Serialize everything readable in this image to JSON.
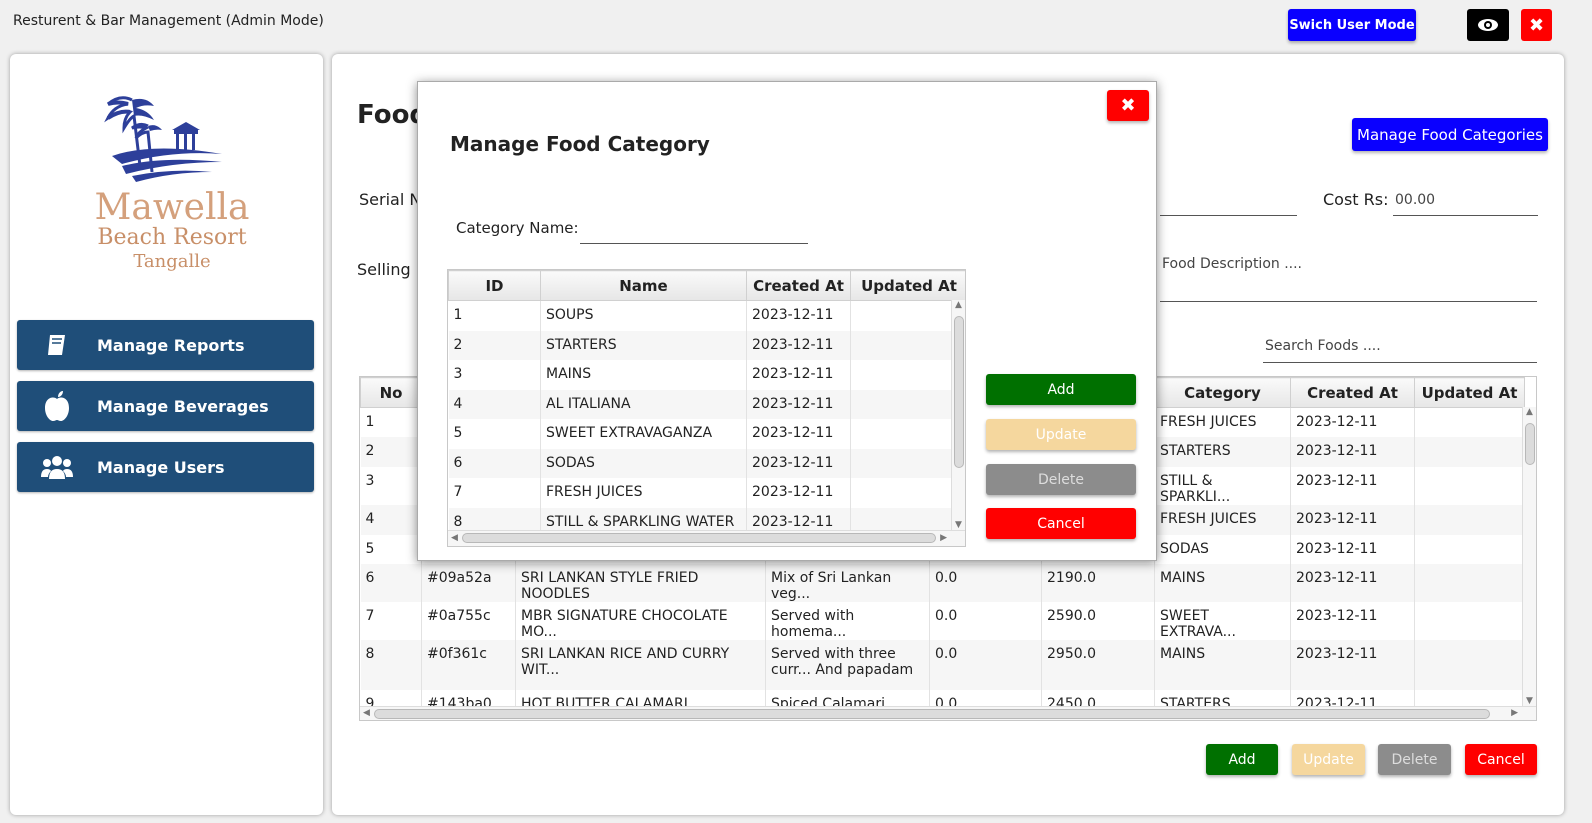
{
  "window": {
    "title": "Resturent & Bar Management (Admin Mode)",
    "switch_label": "Swich User Mode",
    "close_glyph": "✖"
  },
  "colors": {
    "nav": "#1f4e79",
    "blue_btn": "#0a00ff",
    "add": "#007000",
    "update": "#f5d79e",
    "delete": "#8c8c8c",
    "cancel": "#ff0000"
  },
  "sidebar": {
    "logo": {
      "line1": "Mawella",
      "line2": "Beach Resort",
      "line3": "Tangalle"
    },
    "items": [
      {
        "label": "Manage Reports",
        "icon": "book-icon"
      },
      {
        "label": "Manage Beverages",
        "icon": "apple-icon"
      },
      {
        "label": "Manage Users",
        "icon": "users-icon"
      }
    ]
  },
  "main": {
    "title": "Food",
    "manage_categories_label": "Manage Food Categories",
    "serial_label": "Serial N",
    "cost_label": "Cost Rs:",
    "cost_value": "00.00",
    "selling_label": "Selling",
    "description_placeholder": "Food Description ....",
    "search_placeholder": "Search Foods ....",
    "columns": [
      "No",
      "",
      "",
      "",
      "",
      "",
      "Category",
      "Created At",
      "Updated At"
    ],
    "rows": [
      [
        "1",
        "",
        "",
        "",
        "",
        "",
        "FRESH JUICES",
        "2023-12-11",
        ""
      ],
      [
        "2",
        "",
        "",
        "",
        "",
        "",
        "STARTERS",
        "2023-12-11",
        ""
      ],
      [
        "3",
        "",
        "",
        "",
        "",
        "",
        "STILL & SPARKLI...",
        "2023-12-11",
        ""
      ],
      [
        "4",
        "",
        "",
        "",
        "",
        "",
        "FRESH JUICES",
        "2023-12-11",
        ""
      ],
      [
        "5",
        "",
        "",
        "",
        "",
        "",
        "SODAS",
        "2023-12-11",
        ""
      ],
      [
        "6",
        "#09a52a",
        "SRI LANKAN STYLE FRIED NOODLES",
        "Mix of Sri Lankan veg...",
        "0.0",
        "2190.0",
        "MAINS",
        "2023-12-11",
        ""
      ],
      [
        "7",
        "#0a755c",
        "MBR SIGNATURE CHOCOLATE MO...",
        "Served with homema...",
        "0.0",
        "2590.0",
        "SWEET EXTRAVA...",
        "2023-12-11",
        ""
      ],
      [
        "8",
        "#0f361c",
        "SRI LANKAN RICE AND CURRY WIT...",
        "Served with three curr... And papadam",
        "0.0",
        "2950.0",
        "MAINS",
        "2023-12-11",
        ""
      ],
      [
        "9",
        "#143ba0",
        "HOT BUTTER CALAMARI",
        "Spiced Calamari tosse... Toasted Nuts and Dri...",
        "0.0",
        "2450.0",
        "STARTERS",
        "2023-12-11",
        ""
      ]
    ],
    "buttons": {
      "add": "Add",
      "update": "Update",
      "delete": "Delete",
      "cancel": "Cancel"
    }
  },
  "dialog": {
    "title": "Manage Food Category",
    "category_label": "Category Name:",
    "category_value": "",
    "columns": [
      "ID",
      "Name",
      "Created At",
      "Updated At"
    ],
    "rows": [
      [
        "1",
        "SOUPS",
        "2023-12-11",
        ""
      ],
      [
        "2",
        "STARTERS",
        "2023-12-11",
        ""
      ],
      [
        "3",
        "MAINS",
        "2023-12-11",
        ""
      ],
      [
        "4",
        "AL ITALIANA",
        "2023-12-11",
        ""
      ],
      [
        "5",
        "SWEET EXTRAVAGANZA",
        "2023-12-11",
        ""
      ],
      [
        "6",
        "SODAS",
        "2023-12-11",
        ""
      ],
      [
        "7",
        "FRESH JUICES",
        "2023-12-11",
        ""
      ],
      [
        "8",
        "STILL & SPARKLING WATER",
        "2023-12-11",
        ""
      ]
    ],
    "buttons": {
      "add": "Add",
      "update": "Update",
      "delete": "Delete",
      "cancel": "Cancel"
    }
  }
}
